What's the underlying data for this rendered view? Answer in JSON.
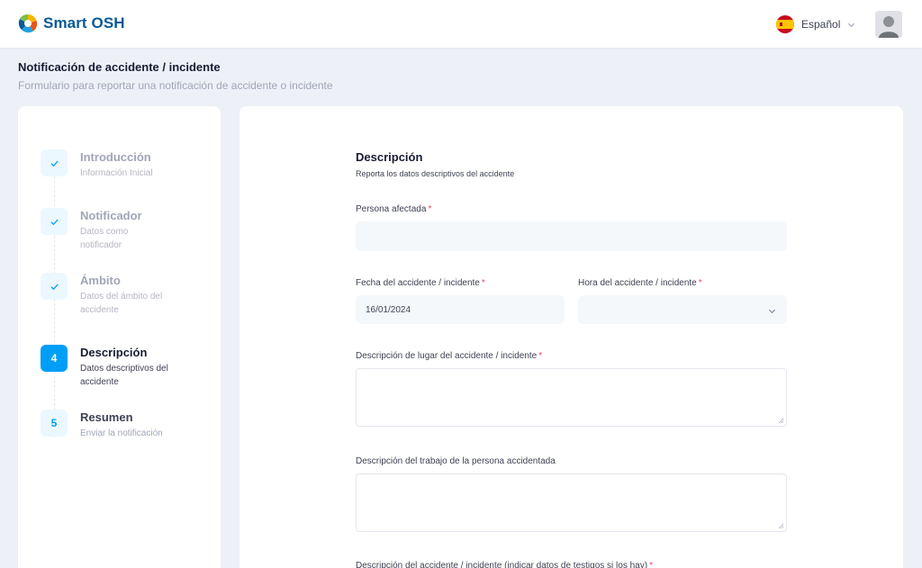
{
  "app": {
    "name": "Smart OSH"
  },
  "header": {
    "language": "Español",
    "icons": {
      "logo": "smart-osh-logo",
      "flag": "spain-flag-icon",
      "chevron": "chevron-down-icon",
      "avatar": "user-avatar"
    }
  },
  "page": {
    "title": "Notificación de accidente / incidente",
    "subtitle": "Formulario para reportar una notificación de accidente o incidente"
  },
  "steps": [
    {
      "title": "Introducción",
      "desc": "Información Inicial",
      "status": "done"
    },
    {
      "title": "Notificador",
      "desc": "Datos como notificador",
      "status": "done"
    },
    {
      "title": "Ámbito",
      "desc": "Datos del ámbito del accidente",
      "status": "done"
    },
    {
      "title": "Descripción",
      "desc": "Datos descriptivos del accidente",
      "status": "current",
      "number": "4"
    },
    {
      "title": "Resumen",
      "desc": "Enviar la notificación",
      "status": "pending",
      "number": "5"
    }
  ],
  "form": {
    "title": "Descripción",
    "subtitle": "Reporta los datos descriptivos del accidente",
    "required_mark": "*",
    "fields": {
      "persona": {
        "label": "Persona afectada",
        "value": ""
      },
      "fecha": {
        "label": "Fecha del accidente / incidente",
        "value": "16/01/2024"
      },
      "hora": {
        "label": "Hora del accidente / incidente",
        "value": ""
      },
      "lugar": {
        "label": "Descripción de lugar del accidente / incidente",
        "value": ""
      },
      "trabajo": {
        "label": "Descripción del trabajo de la persona accidentada",
        "value": ""
      },
      "accidente": {
        "label": "Descripción del accidente / incidente (indicar datos de testigos si los hay)"
      }
    }
  },
  "colors": {
    "primary": "#009ef7",
    "brand": "#0a5a96",
    "required": "#f1416c",
    "background": "#eef0f8"
  }
}
